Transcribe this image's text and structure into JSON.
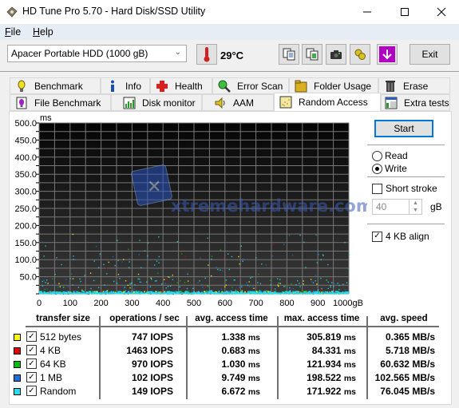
{
  "window": {
    "title": "HD Tune Pro 5.70 - Hard Disk/SSD Utility",
    "controls": [
      "minimize",
      "maximize",
      "close"
    ]
  },
  "menu": {
    "items": [
      {
        "label": "File",
        "accel": "F",
        "rest": "ile"
      },
      {
        "label": "Help",
        "accel": "H",
        "rest": "elp"
      }
    ]
  },
  "toolbar": {
    "drive": "Apacer  Portable HDD (1000 gB)",
    "temperature": "29°C",
    "icons": [
      "copy-text-icon",
      "copy-screenshot-icon",
      "camera-icon",
      "options-icon",
      "save-download-icon"
    ],
    "exit_label": "Exit"
  },
  "tabs": {
    "row1": [
      {
        "label": "Benchmark",
        "icon": "lightbulb-icon"
      },
      {
        "label": "Info",
        "icon": "info-icon"
      },
      {
        "label": "Health",
        "icon": "health-cross-icon"
      },
      {
        "label": "Error Scan",
        "icon": "magnifier-icon"
      },
      {
        "label": "Folder Usage",
        "icon": "folder-icon"
      },
      {
        "label": "Erase",
        "icon": "trash-icon"
      }
    ],
    "row2": [
      {
        "label": "File Benchmark",
        "icon": "file-benchmark-icon"
      },
      {
        "label": "Disk monitor",
        "icon": "disk-monitor-icon"
      },
      {
        "label": "AAM",
        "icon": "speaker-icon"
      },
      {
        "label": "Random Access",
        "icon": "random-access-icon",
        "active": true
      },
      {
        "label": "Extra tests",
        "icon": "extra-tests-icon"
      }
    ]
  },
  "controls": {
    "start_label": "Start",
    "mode_options": [
      {
        "label": "Read",
        "selected": false
      },
      {
        "label": "Write",
        "selected": true
      }
    ],
    "short_stroke": {
      "label": "Short stroke",
      "checked": false
    },
    "short_stroke_value": "40",
    "short_stroke_unit": "gB",
    "align_4kb": {
      "label": "4 KB align",
      "checked": true
    }
  },
  "chart_data": {
    "type": "scatter",
    "title": "",
    "ylabel": "ms",
    "xlabel": "gB",
    "ylim": [
      0,
      500
    ],
    "xlim": [
      0,
      1000
    ],
    "yticks": [
      "500.0",
      "450.0",
      "400.0",
      "350.0",
      "300.0",
      "250.0",
      "200.0",
      "150.0",
      "100.0",
      "50.0"
    ],
    "xticks": [
      "0",
      "100",
      "200",
      "300",
      "400",
      "500",
      "600",
      "700",
      "800",
      "900",
      "1000gB"
    ],
    "grid": true,
    "background": "#2b2b2b",
    "watermark": "xtremehardware.com",
    "series": [
      {
        "name": "512 bytes",
        "color": "#ffff00"
      },
      {
        "name": "4 KB",
        "color": "#e00000"
      },
      {
        "name": "64 KB",
        "color": "#00c000"
      },
      {
        "name": "1 MB",
        "color": "#1e6fd9"
      },
      {
        "name": "Random",
        "color": "#22e0f0"
      }
    ],
    "note": "Dense band of points near 0–10 ms across full capacity; sparse outliers up to ~170 ms"
  },
  "results": {
    "headers": [
      "transfer size",
      "operations / sec",
      "avg. access time",
      "max. access time",
      "avg. speed"
    ],
    "rows": [
      {
        "label": "512 bytes",
        "color": "#ffff00",
        "checked": true,
        "ops": "747 IOPS",
        "avg_access": "1.338",
        "max_access": "305.819",
        "speed": "0.365 MB/s"
      },
      {
        "label": "4 KB",
        "color": "#e00000",
        "checked": true,
        "ops": "1463 IOPS",
        "avg_access": "0.683",
        "max_access": "84.331",
        "speed": "5.718 MB/s"
      },
      {
        "label": "64 KB",
        "color": "#00c000",
        "checked": true,
        "ops": "970 IOPS",
        "avg_access": "1.030",
        "max_access": "121.934",
        "speed": "60.632 MB/s"
      },
      {
        "label": "1 MB",
        "color": "#1e6fd9",
        "checked": true,
        "ops": "102 IOPS",
        "avg_access": "9.749",
        "max_access": "198.522",
        "speed": "102.565 MB/s"
      },
      {
        "label": "Random",
        "color": "#22e0f0",
        "checked": true,
        "ops": "149 IOPS",
        "avg_access": "6.672",
        "max_access": "171.922",
        "speed": "76.045 MB/s"
      }
    ],
    "time_unit": "ms"
  }
}
